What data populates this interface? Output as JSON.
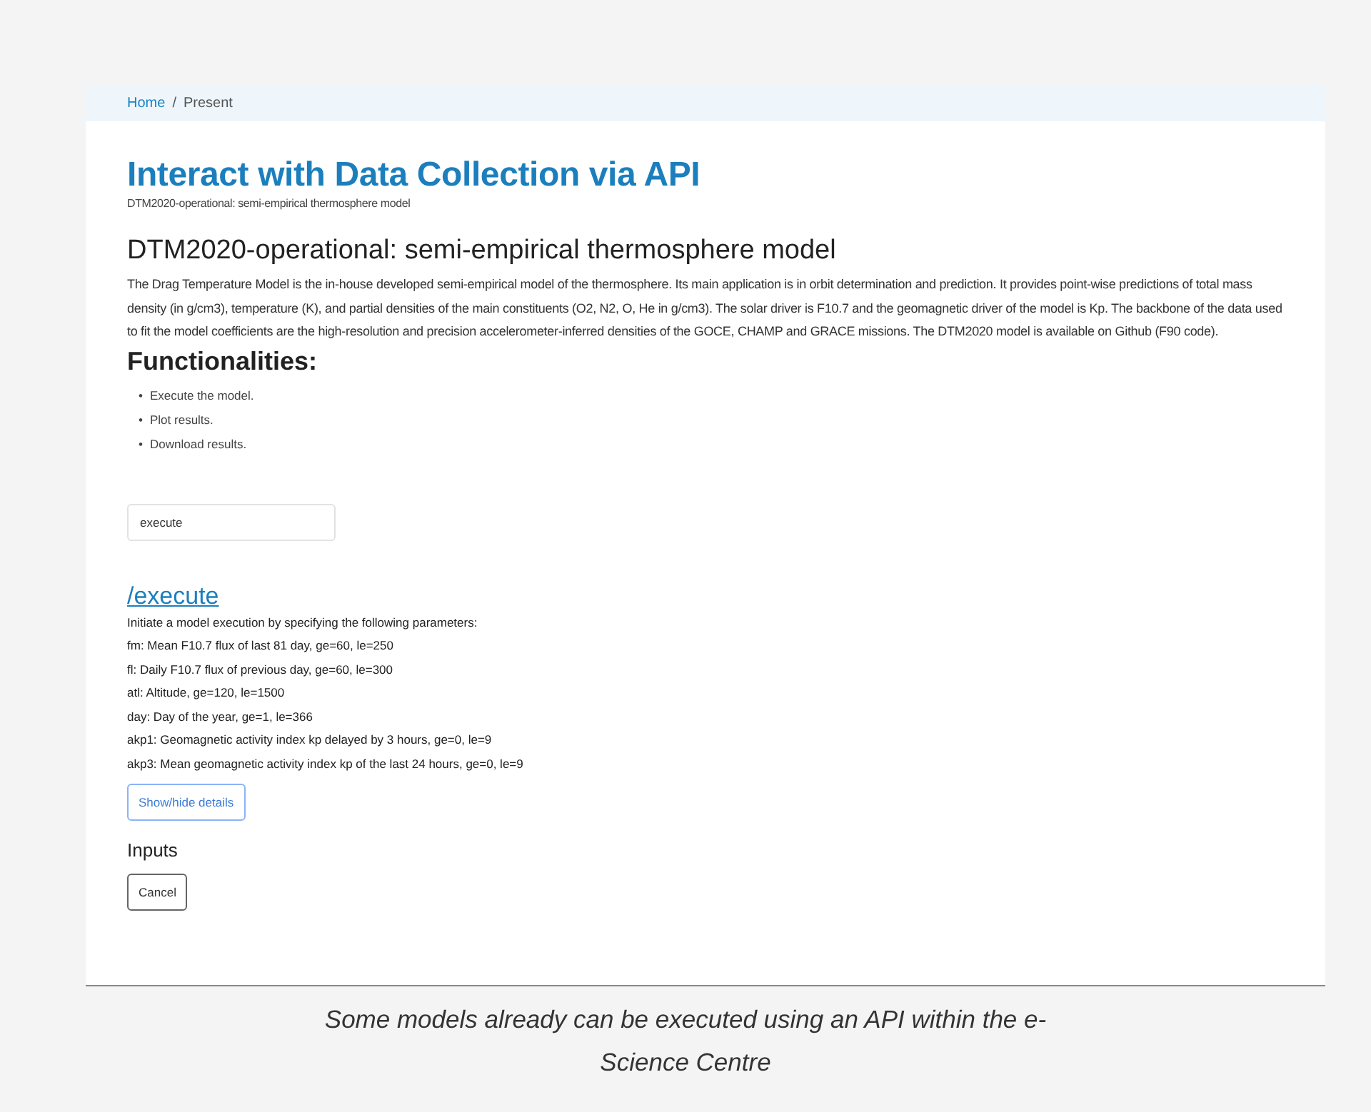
{
  "breadcrumb": {
    "items": [
      {
        "label": "Home",
        "link": true
      },
      {
        "label": "Present",
        "link": false
      }
    ],
    "separator": "/"
  },
  "title": "Interact with Data Collection via API",
  "subtitle": "DTM2020-operational: semi-empirical thermosphere model",
  "model_heading": "DTM2020-operational: semi-empirical thermosphere model",
  "description": "The Drag Temperature Model is the in-house developed semi-empirical model of the thermosphere. Its main application is in orbit determination and prediction. It provides point-wise predictions of total mass density (in g/cm3), temperature (K), and partial densities of the main constituents (O2, N2, O, He in g/cm3). The solar driver is F10.7 and the geomagnetic driver of the model is Kp. The backbone of the data used to fit the model coefficients are the high-resolution and precision accelerometer-inferred densities of the GOCE, CHAMP and GRACE missions. The DTM2020 model is available on Github (F90 code).",
  "functionalities": {
    "heading": "Functionalities:",
    "items": [
      {
        "marker": "•",
        "text": "Execute the model."
      },
      {
        "marker": "•",
        "text": "Plot results."
      },
      {
        "marker": "•",
        "text": "Download results."
      }
    ]
  },
  "endpoint_field": {
    "value": "execute"
  },
  "endpoint": {
    "link": "/execute",
    "intro": "Initiate a model execution by specifying the following parameters:",
    "parameters": [
      "fm: Mean F10.7 flux of last 81 day, ge=60, le=250",
      "fl: Daily F10.7 flux of previous day, ge=60, le=300",
      "atl: Altitude, ge=120, le=1500",
      "day: Day of the year, ge=1, le=366",
      "akp1: Geomagnetic activity index kp delayed by 3 hours, ge=0, le=9",
      "akp3: Mean geomagnetic activity index kp of the last 24 hours, ge=0, le=9"
    ]
  },
  "details_button": "Show/hide details",
  "inputs_heading": "Inputs",
  "cancel_button": "Cancel",
  "caption": "Some models already can be executed using an API within the e-Science Centre"
}
